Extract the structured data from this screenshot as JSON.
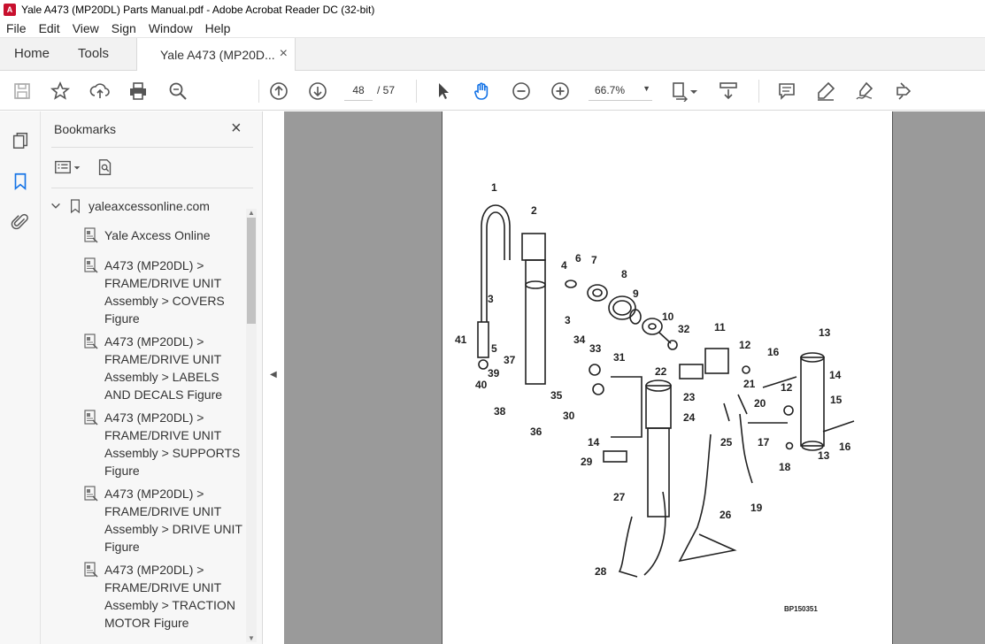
{
  "window": {
    "title": "Yale A473 (MP20DL) Parts Manual.pdf - Adobe Acrobat Reader DC (32-bit)"
  },
  "menu": [
    "File",
    "Edit",
    "View",
    "Sign",
    "Window",
    "Help"
  ],
  "tabs": {
    "home": "Home",
    "tools": "Tools",
    "document": "Yale A473 (MP20D...",
    "close": "×"
  },
  "toolbar": {
    "page_current": "48",
    "page_total": "/  57",
    "zoom": "66.7%",
    "icons": [
      "save-icon",
      "star-icon",
      "upload-icon",
      "print-icon",
      "zoom-search-icon",
      "page-up-icon",
      "page-down-icon",
      "select-cursor-icon",
      "hand-icon",
      "zoom-out-icon",
      "zoom-in-icon",
      "page-fit-icon",
      "scroll-mode-icon",
      "comment-icon",
      "highlight-icon",
      "sign-icon",
      "more-tools-icon"
    ]
  },
  "bookmarks": {
    "title": "Bookmarks",
    "close": "×",
    "root": "yaleaxcessonline.com",
    "items": [
      "Yale Axcess Online",
      "A473 (MP20DL) > FRAME/DRIVE UNIT Assembly > COVERS Figure",
      "A473 (MP20DL) > FRAME/DRIVE UNIT Assembly > LABELS AND DECALS Figure",
      "A473 (MP20DL) > FRAME/DRIVE UNIT Assembly > SUPPORTS Figure",
      "A473 (MP20DL) > FRAME/DRIVE UNIT Assembly > DRIVE UNIT Figure",
      "A473 (MP20DL) > FRAME/DRIVE UNIT Assembly > TRACTION MOTOR Figure"
    ]
  },
  "drawing": {
    "code": "BP150351",
    "labels": [
      "1",
      "2",
      "3",
      "3",
      "4",
      "5",
      "6",
      "7",
      "8",
      "9",
      "10",
      "11",
      "12",
      "12",
      "13",
      "13",
      "14",
      "14",
      "15",
      "16",
      "16",
      "17",
      "18",
      "19",
      "20",
      "21",
      "22",
      "23",
      "24",
      "25",
      "26",
      "27",
      "28",
      "29",
      "30",
      "31",
      "32",
      "33",
      "34",
      "35",
      "36",
      "37",
      "38",
      "39",
      "40",
      "41"
    ]
  }
}
